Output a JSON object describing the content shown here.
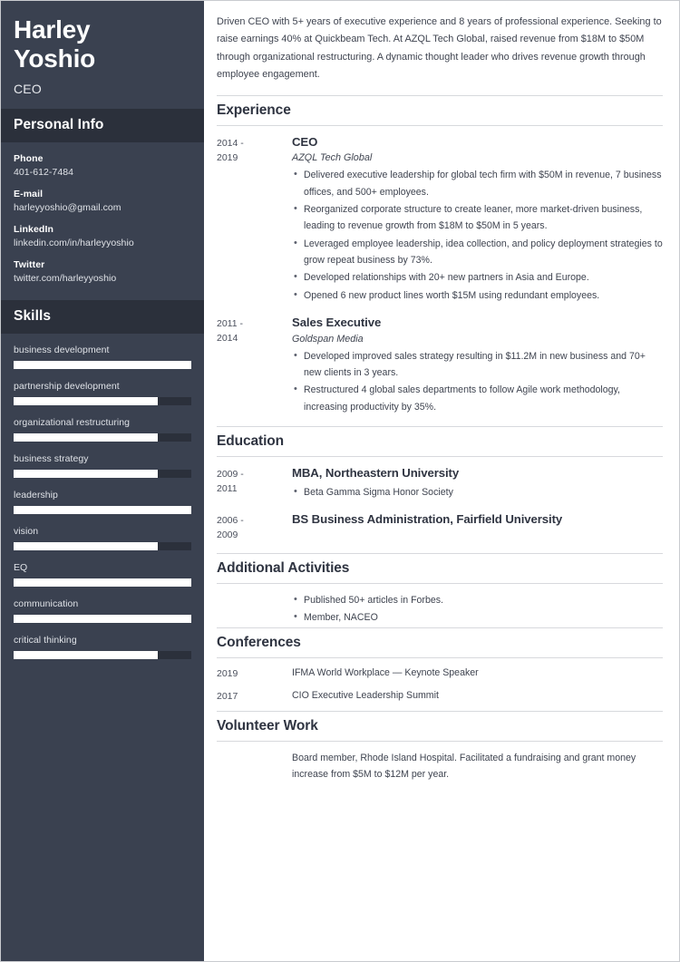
{
  "sidebar": {
    "name": "Harley Yoshio",
    "name_line1": "Harley",
    "name_line2": "Yoshio",
    "job_title": "CEO",
    "personal_info_heading": "Personal Info",
    "contacts": [
      {
        "label": "Phone",
        "value": "401-612-7484"
      },
      {
        "label": "E-mail",
        "value": "harleyyoshio@gmail.com"
      },
      {
        "label": "LinkedIn",
        "value": "linkedin.com/in/harleyyoshio"
      },
      {
        "label": "Twitter",
        "value": "twitter.com/harleyyoshio"
      }
    ],
    "skills_heading": "Skills",
    "skills": [
      {
        "label": "business development",
        "level": 100
      },
      {
        "label": "partnership development",
        "level": 81
      },
      {
        "label": "organizational restructuring",
        "level": 81
      },
      {
        "label": "business strategy",
        "level": 81
      },
      {
        "label": "leadership",
        "level": 100
      },
      {
        "label": "vision",
        "level": 81
      },
      {
        "label": "EQ",
        "level": 100
      },
      {
        "label": "communication",
        "level": 100
      },
      {
        "label": "critical thinking",
        "level": 81
      }
    ],
    "colors": {
      "background": "#3a4150",
      "header_band": "#2b303b",
      "bar_fill": "#ffffff",
      "bar_track": "#2b303b"
    }
  },
  "main": {
    "summary": "Driven CEO with 5+ years of executive experience and 8 years of professional experience. Seeking to raise earnings 40% at Quickbeam Tech. At AZQL Tech Global, raised revenue from $18M to $50M through organizational restructuring. A dynamic thought leader who drives revenue growth through employee engagement.",
    "sections": {
      "experience": {
        "title": "Experience",
        "entries": [
          {
            "date": "2014 - 2019",
            "date_line1": "2014 -",
            "date_line2": "2019",
            "title": "CEO",
            "org": "AZQL Tech Global",
            "bullets": [
              "Delivered executive leadership for global tech firm with $50M in revenue, 7 business offices, and 500+ employees.",
              "Reorganized corporate structure to create leaner, more market-driven business, leading to revenue growth from $18M to $50M in 5 years.",
              "Leveraged employee leadership, idea collection, and policy deployment strategies to grow repeat business by 73%.",
              "Developed relationships with 20+ new partners in Asia and Europe.",
              "Opened 6 new product lines worth $15M using redundant employees."
            ]
          },
          {
            "date": "2011 - 2014",
            "date_line1": "2011 -",
            "date_line2": "2014",
            "title": "Sales Executive",
            "org": "Goldspan Media",
            "bullets": [
              "Developed improved sales strategy resulting in $11.2M in new business and 70+ new clients in 3 years.",
              "Restructured 4 global sales departments to follow Agile work methodology, increasing productivity by 35%."
            ]
          }
        ]
      },
      "education": {
        "title": "Education",
        "entries": [
          {
            "date": "2009 - 2011",
            "date_line1": "2009 -",
            "date_line2": "2011",
            "title": "MBA, Northeastern University",
            "bullets": [
              "Beta Gamma Sigma Honor Society"
            ]
          },
          {
            "date": "2006 - 2009",
            "date_line1": "2006 -",
            "date_line2": "2009",
            "title": "BS Business Administration, Fairfield University",
            "bullets": []
          }
        ]
      },
      "additional_activities": {
        "title": "Additional Activities",
        "bullets": [
          "Published 50+ articles in Forbes.",
          "Member, NACEO"
        ]
      },
      "conferences": {
        "title": "Conferences",
        "entries": [
          {
            "date": "2019",
            "text": "IFMA World Workplace — Keynote Speaker"
          },
          {
            "date": "2017",
            "text": "CIO Executive Leadership Summit"
          }
        ]
      },
      "volunteer_work": {
        "title": "Volunteer Work",
        "text": "Board member, Rhode Island Hospital. Facilitated a fundraising and grant money increase from $5M to $12M per year."
      }
    }
  }
}
